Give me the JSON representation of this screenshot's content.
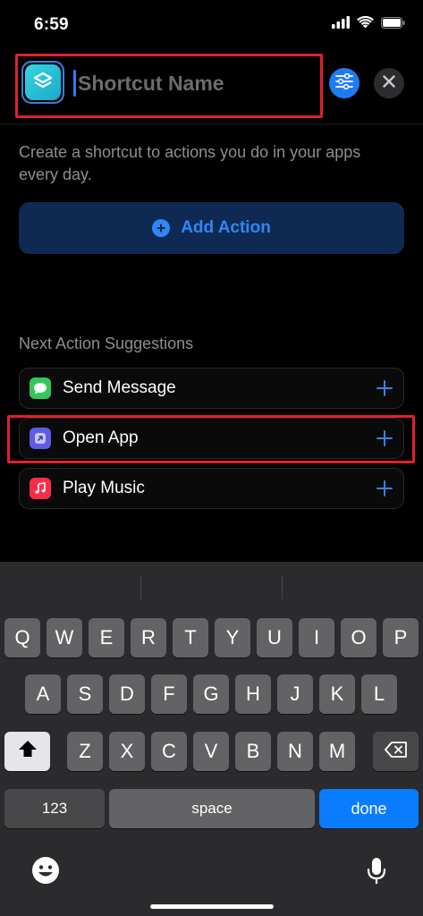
{
  "status": {
    "time": "6:59"
  },
  "header": {
    "name_placeholder": "Shortcut Name"
  },
  "main": {
    "description": "Create a shortcut to actions you do in your apps every day.",
    "add_action_label": "Add Action",
    "suggestions_title": "Next Action Suggestions",
    "suggestions": [
      {
        "label": "Send Message",
        "icon": "messages-icon",
        "color": "#34c759"
      },
      {
        "label": "Open App",
        "icon": "open-app-icon",
        "color": "#5e5ce6"
      },
      {
        "label": "Play Music",
        "icon": "music-icon",
        "color": "#fa2d48"
      }
    ]
  },
  "keyboard": {
    "row1": [
      "Q",
      "W",
      "E",
      "R",
      "T",
      "Y",
      "U",
      "I",
      "O",
      "P"
    ],
    "row2": [
      "A",
      "S",
      "D",
      "F",
      "G",
      "H",
      "J",
      "K",
      "L"
    ],
    "row3": [
      "Z",
      "X",
      "C",
      "V",
      "B",
      "N",
      "M"
    ],
    "numbers_label": "123",
    "space_label": "space",
    "done_label": "done"
  },
  "colors": {
    "accent": "#2f86f5",
    "highlight": "#e0202d",
    "done": "#0a7cff"
  }
}
